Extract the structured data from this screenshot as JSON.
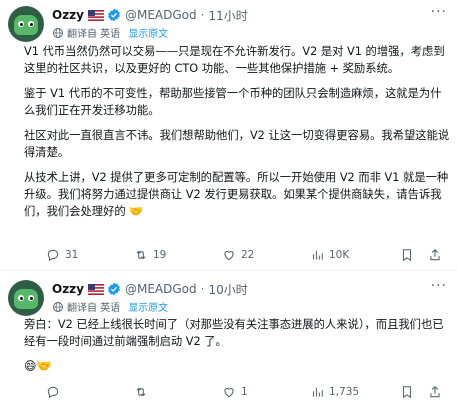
{
  "tweets": [
    {
      "author_name": "Ozzy",
      "handle": "@MEADGod",
      "dot": "·",
      "time": "11小时",
      "translate_label": "翻译自 英语",
      "show_original": "显示原文",
      "paragraphs": [
        "V1 代币当然仍然可以交易——只是现在不允许新发行。V2 是对 V1 的增强，考虑到这里的社区共识，以及更好的 CTO 功能、一些其他保护措施 + 奖励系统。",
        "鉴于 V1 代币的不可变性，帮助那些接管一个币种的团队只会制造麻烦，这就是为什么我们正在开发迁移功能。",
        "社区对此一直很直言不讳。我们想帮助他们，V2 让这一切变得更容易。我希望这能说得清楚。",
        "从技术上讲，V2 提供了更多可定制的配置等。所以一开始使用 V2 而非 V1 就是一种升级。我们将努力通过提供商让 V2 发行更易获取。如果某个提供商缺失，请告诉我们，我们会处理好的 🤝"
      ],
      "actions": {
        "replies": "31",
        "reposts": "19",
        "likes": "22",
        "views": "10K"
      }
    },
    {
      "author_name": "Ozzy",
      "handle": "@MEADGod",
      "dot": "·",
      "time": "10小时",
      "translate_label": "翻译自 英语",
      "show_original": "显示原文",
      "paragraphs": [
        "旁白：V2 已经上线很长时间了（对那些没有关注事态进展的人来说），而且我们也已经有一段时间通过前端强制启动 V2 了。",
        "😄🤝"
      ],
      "actions": {
        "replies": "",
        "reposts": "",
        "likes": "1",
        "views": "1,735"
      }
    }
  ],
  "more_icon": "more-horizontal-icon",
  "colors": {
    "accent": "#1d9bf0",
    "muted": "#536471",
    "text": "#0f1419"
  }
}
